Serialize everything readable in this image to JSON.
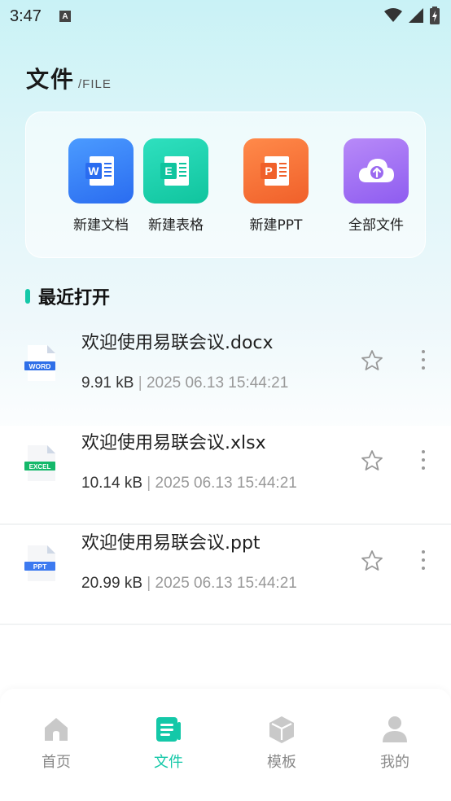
{
  "status": {
    "time": "3:47",
    "notification": "A"
  },
  "header": {
    "title": "文件",
    "subtitle": "/FILE"
  },
  "quick_actions": [
    {
      "label": "新建文档",
      "icon": "word-doc-icon",
      "color": "#2f7bf5",
      "glyph": "W"
    },
    {
      "label": "新建表格",
      "icon": "excel-sheet-icon",
      "color": "#14c8a8",
      "glyph": "E"
    },
    {
      "label": "新建PPT",
      "icon": "ppt-slides-icon",
      "color": "#f26c2d",
      "glyph": "P"
    },
    {
      "label": "全部文件",
      "icon": "cloud-upload-icon",
      "color": "#9b6af0",
      "glyph": ""
    }
  ],
  "recent": {
    "title": "最近打开",
    "files": [
      {
        "name": "欢迎使用易联会议.docx",
        "size": "9.91 kB",
        "separator": " | ",
        "date": "2025 06.13 15:44:21",
        "badge": "WORD",
        "badge_color": "#2f6fe8"
      },
      {
        "name": "欢迎使用易联会议.xlsx",
        "size": "10.14 kB",
        "separator": " | ",
        "date": "2025 06.13 15:44:21",
        "badge": "EXCEL",
        "badge_color": "#14b86a"
      },
      {
        "name": "欢迎使用易联会议.ppt",
        "size": "20.99 kB",
        "separator": " | ",
        "date": "2025 06.13 15:44:21",
        "badge": "PPT",
        "badge_color": "#3d7af0"
      }
    ]
  },
  "tabs": [
    {
      "label": "首页",
      "icon": "home-icon",
      "active": false
    },
    {
      "label": "文件",
      "icon": "file-icon",
      "active": true
    },
    {
      "label": "模板",
      "icon": "template-cube-icon",
      "active": false
    },
    {
      "label": "我的",
      "icon": "profile-icon",
      "active": false
    }
  ],
  "colors": {
    "accent": "#14c8a8",
    "inactive": "#c9c9c9"
  }
}
